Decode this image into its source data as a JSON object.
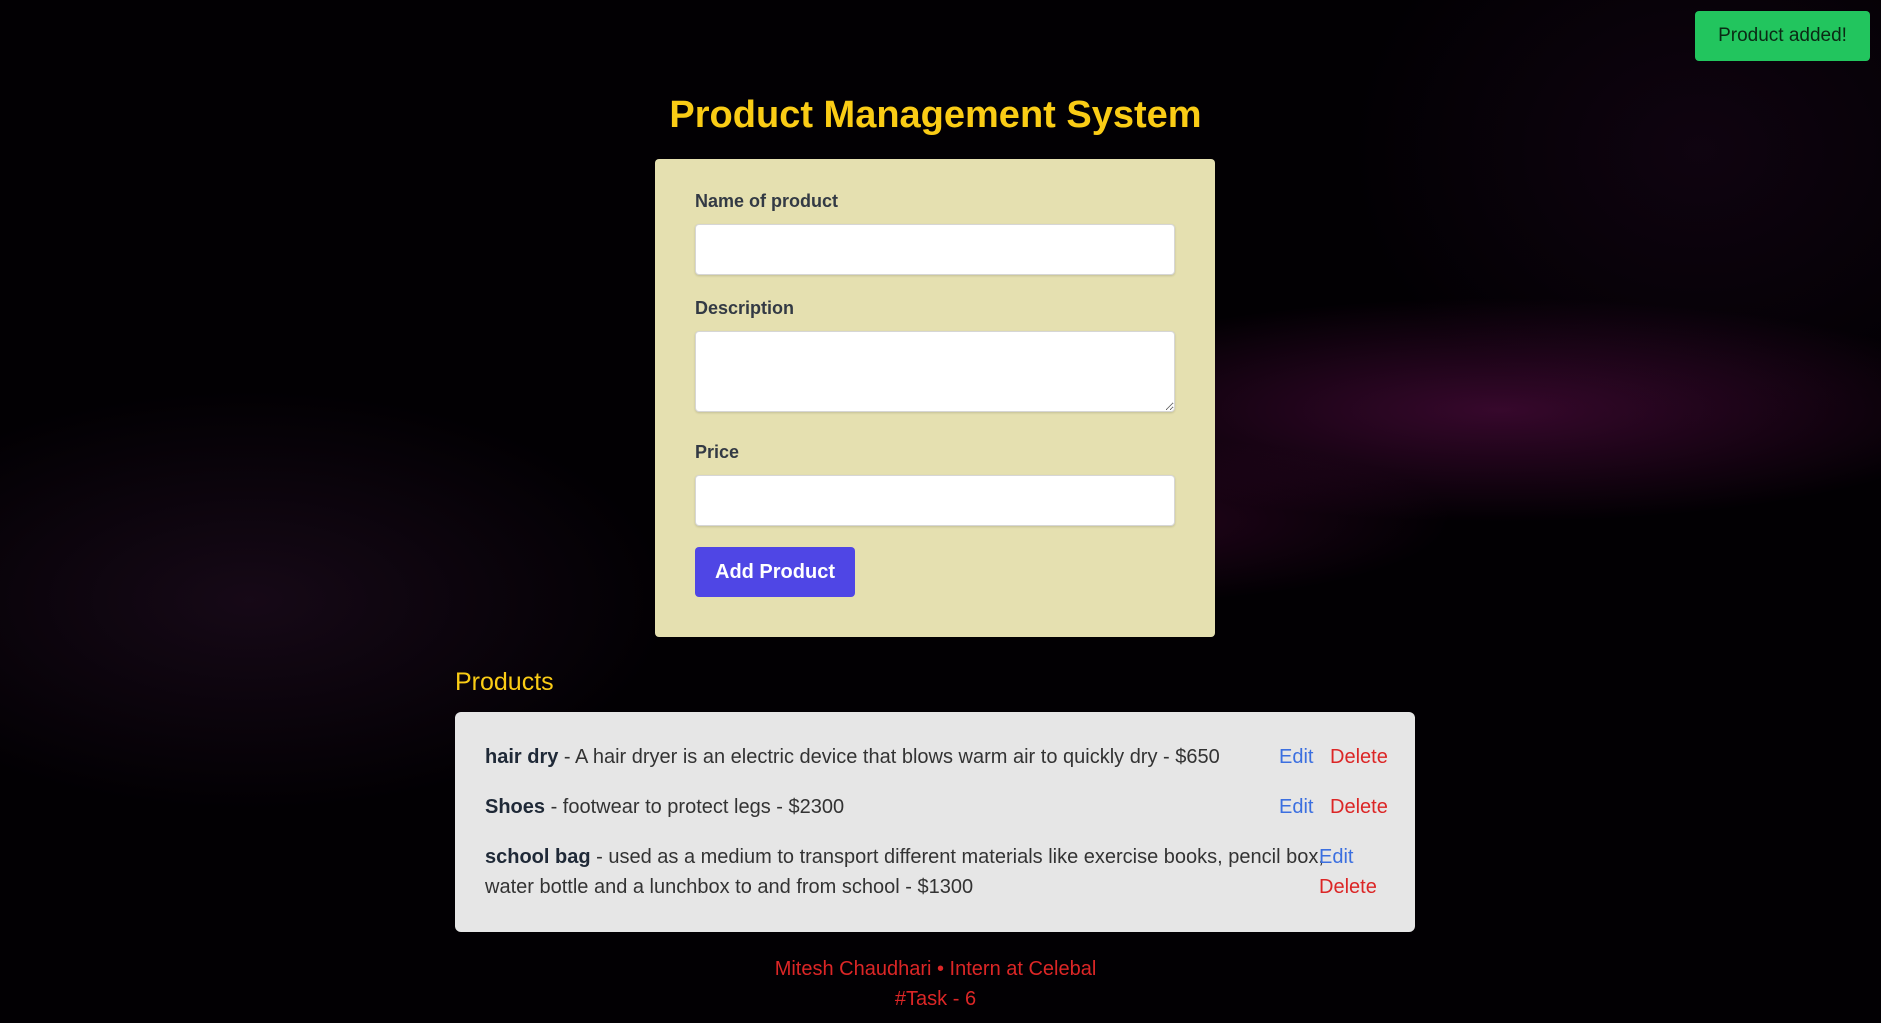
{
  "toast": {
    "message": "Product added!",
    "color": "#22c55e"
  },
  "header": {
    "title": "Product Management System",
    "title_color": "#facc15"
  },
  "form": {
    "background": "#e5e0b0",
    "name_label": "Name of product",
    "name_value": "",
    "description_label": "Description",
    "description_value": "",
    "price_label": "Price",
    "price_value": "",
    "submit_label": "Add Product",
    "submit_color": "#4f46e5"
  },
  "products": {
    "heading": "Products",
    "edit_label": "Edit",
    "delete_label": "Delete",
    "items": [
      {
        "name": "hair dry",
        "rest": " - A hair dryer is an electric device that blows warm air to quickly dry - $650"
      },
      {
        "name": "Shoes",
        "rest": " - footwear to protect legs - $2300"
      },
      {
        "name": "school bag",
        "rest_line1": " - used as a medium to transport different materials like exercise books, pencil box,",
        "rest_line2": "water bottle and a lunchbox to and from school - $1300"
      }
    ]
  },
  "footer": {
    "line1": "Mitesh Chaudhari • Intern at Celebal",
    "line2": "#Task - 6",
    "color": "#dc2626"
  }
}
